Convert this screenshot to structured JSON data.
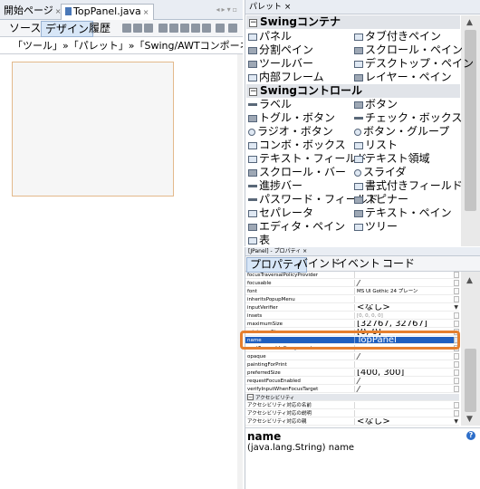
{
  "editor": {
    "tabs": [
      {
        "label": "開始ページ",
        "close": "×"
      },
      {
        "label": "TopPanel.java",
        "close": "×"
      }
    ],
    "modes": [
      "ソース",
      "デザイン",
      "履歴"
    ],
    "active_mode": "デザイン",
    "breadcrumb": "「ツール」»「パレット」»「Swing/AWTコンポーネント」メニュー項"
  },
  "palette": {
    "title": "パレット ×",
    "categories": [
      {
        "label": "Swingコンテナ",
        "items": [
          [
            "パネル",
            "タブ付きペイン"
          ],
          [
            "分割ペイン",
            "スクロール・ペイン"
          ],
          [
            "ツールバー",
            "デスクトップ・ペイン"
          ],
          [
            "内部フレーム",
            "レイヤー・ペイン"
          ]
        ]
      },
      {
        "label": "Swingコントロール",
        "items": [
          [
            "ラベル",
            "ボタン"
          ],
          [
            "トグル・ボタン",
            "チェック・ボックス"
          ],
          [
            "ラジオ・ボタン",
            "ボタン・グループ"
          ],
          [
            "コンボ・ボックス",
            "リスト"
          ],
          [
            "テキスト・フィールド",
            "テキスト領域"
          ],
          [
            "スクロール・バー",
            "スライダ"
          ],
          [
            "進捗バー",
            "書式付きフィールド"
          ],
          [
            "パスワード・フィールド",
            "スピナー"
          ],
          [
            "セパレータ",
            "テキスト・ペイン"
          ],
          [
            "エディタ・ペイン",
            "ツリー"
          ],
          [
            "表",
            ""
          ]
        ]
      }
    ]
  },
  "properties": {
    "title": "[JPanel] - プロパティ ×",
    "tabs": [
      "プロパティ",
      "バインド",
      "イベント",
      "コード"
    ],
    "rows": [
      {
        "name": "focusTraversalPolicyProvider",
        "value": "",
        "check": false
      },
      {
        "name": "focusable",
        "value": "",
        "check": true
      },
      {
        "name": "font",
        "value": "MS UI Gothic 24 プレーン",
        "check": false
      },
      {
        "name": "inheritsPopupMenu",
        "value": "",
        "check": false
      },
      {
        "name": "inputVerifier",
        "value": "<なし>",
        "check": false
      },
      {
        "name": "insets",
        "value": "[0, 0, 0, 0]",
        "check": false
      },
      {
        "name": "maximumSize",
        "value": "[32767, 32767]",
        "check": false
      },
      {
        "name": "minimumSize",
        "value": "[0, 0]",
        "check": false
      },
      {
        "name": "name",
        "value": "TopPanel",
        "check": false
      },
      {
        "name": "nextFocusableComponent",
        "value": "",
        "check": false
      },
      {
        "name": "opaque",
        "value": "",
        "check": true
      },
      {
        "name": "paintingForPrint",
        "value": "",
        "check": false
      },
      {
        "name": "preferredSize",
        "value": "[400, 300]",
        "check": false
      },
      {
        "name": "requestFocusEnabled",
        "value": "",
        "check": true
      },
      {
        "name": "verifyInputWhenFocusTarget",
        "value": "",
        "check": true
      },
      {
        "name": "アクセシビリティ",
        "value": "",
        "check": false
      },
      {
        "name": "アクセシビリティ対応の名前",
        "value": "",
        "check": false
      },
      {
        "name": "アクセシビリティ対応の説明",
        "value": "",
        "check": false
      },
      {
        "name": "アクセシビリティ対応の親",
        "value": "<なし>",
        "check": false
      }
    ],
    "description": {
      "title": "name",
      "text": "(java.lang.String) name"
    },
    "help_icon": "?"
  }
}
